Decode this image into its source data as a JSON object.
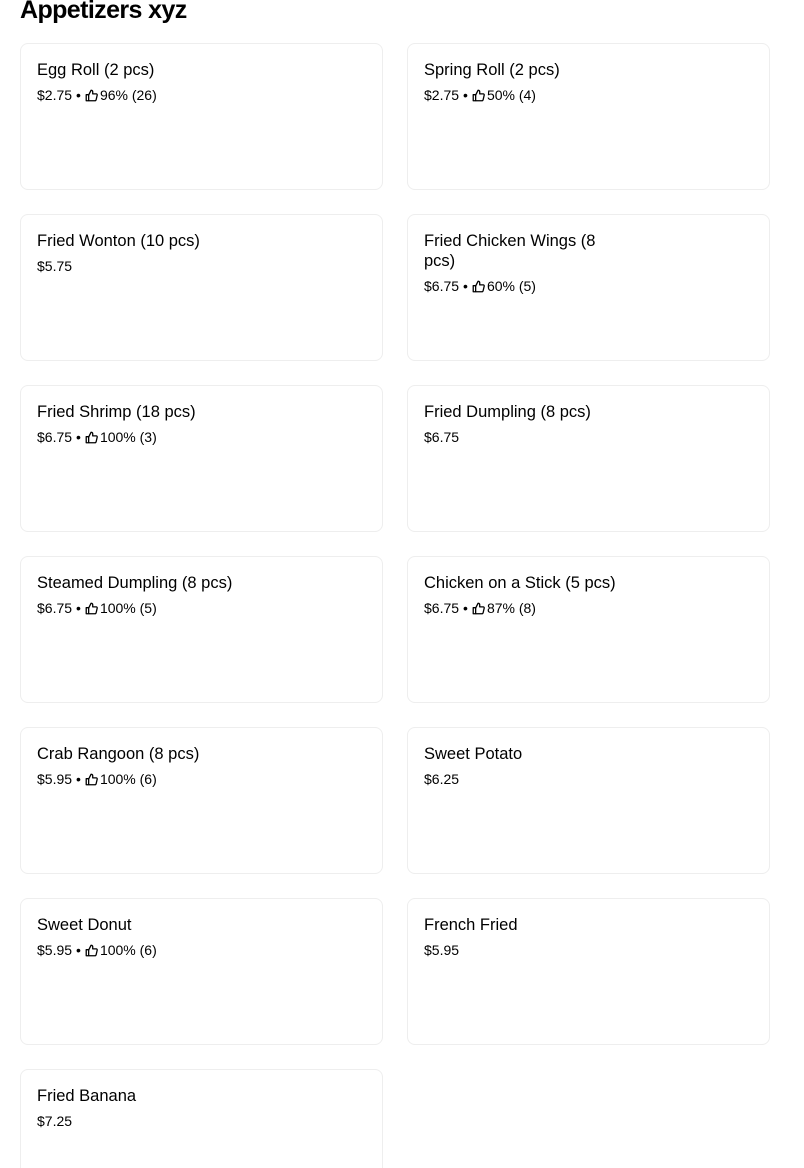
{
  "section": {
    "title": "Appetizers xyz"
  },
  "items": [
    {
      "name": "Egg Roll (2 pcs)",
      "price": "$2.75",
      "rating": "96% (26)"
    },
    {
      "name": "Spring Roll (2 pcs)",
      "price": "$2.75",
      "rating": "50% (4)"
    },
    {
      "name": "Fried Wonton (10 pcs)",
      "price": "$5.75",
      "rating": ""
    },
    {
      "name": "Fried Chicken Wings (8 pcs)",
      "price": "$6.75",
      "rating": "60% (5)"
    },
    {
      "name": "Fried Shrimp (18 pcs)",
      "price": "$6.75",
      "rating": "100% (3)"
    },
    {
      "name": "Fried Dumpling (8 pcs)",
      "price": "$6.75",
      "rating": ""
    },
    {
      "name": "Steamed Dumpling (8 pcs)",
      "price": "$6.75",
      "rating": "100% (5)"
    },
    {
      "name": "Chicken on a Stick (5 pcs)",
      "price": "$6.75",
      "rating": "87% (8)"
    },
    {
      "name": "Crab Rangoon (8 pcs)",
      "price": "$5.95",
      "rating": "100% (6)"
    },
    {
      "name": "Sweet Potato",
      "price": "$6.25",
      "rating": ""
    },
    {
      "name": "Sweet Donut",
      "price": "$5.95",
      "rating": "100% (6)"
    },
    {
      "name": "French Fried",
      "price": "$5.95",
      "rating": ""
    },
    {
      "name": "Fried Banana",
      "price": "$7.25",
      "rating": ""
    }
  ],
  "meta": {
    "separator": "•",
    "rating_icon": "thumbs-up-icon"
  }
}
